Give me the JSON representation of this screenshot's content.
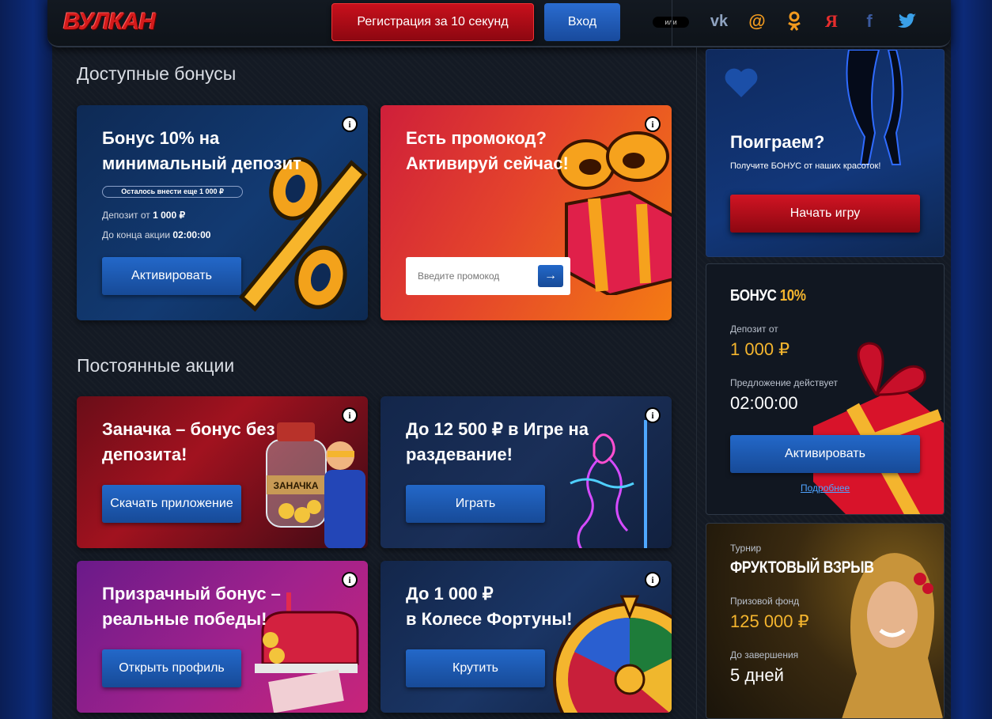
{
  "header": {
    "logo": "ВУЛКАН",
    "register_label": "Регистрация за 10 секунд",
    "login_label": "Вход",
    "or_label": "или",
    "socials": [
      "vk-icon",
      "mail-at-icon",
      "odnoklassniki-icon",
      "yandex-icon",
      "facebook-icon",
      "twitter-icon"
    ]
  },
  "available": {
    "title": "Доступные бонусы",
    "bonus10": {
      "title_line1": "Бонус 10% на",
      "title_line2": "минимальный депозит",
      "remaining": "Осталось внести еще 1 000 ₽",
      "deposit_label": "Депозит от",
      "deposit_value": "1 000 ₽",
      "ends_label": "До конца акции",
      "ends_value": "02:00:00",
      "button": "Активировать"
    },
    "promo": {
      "title_line1": "Есть промокод?",
      "title_line2": "Активируй сейчас!",
      "placeholder": "Введите промокод",
      "submit_glyph": "→"
    }
  },
  "permanent": {
    "title": "Постоянные акции",
    "cards": [
      {
        "line1": "Заначка – бонус без",
        "line2": "депозита!",
        "button": "Скачать приложение",
        "jar_label": "ЗАНАЧКА"
      },
      {
        "line1": "До 12 500 ₽ в Игре на",
        "line2": "раздевание!",
        "button": "Играть"
      },
      {
        "line1": "Призрачный бонус –",
        "line2": "реальные победы!",
        "button": "Открыть профиль"
      },
      {
        "line1": "До 1 000 ₽",
        "line2": "в Колесе Фортуны!",
        "button": "Крутить"
      }
    ]
  },
  "sidebar": {
    "play": {
      "title": "Поиграем?",
      "subtitle": "Получите БОНУС от наших красоток!",
      "button": "Начать игру"
    },
    "bonus": {
      "title": "БОНУС",
      "title_accent": "10%",
      "deposit_label": "Депозит от",
      "deposit_value": "1 000 ₽",
      "offer_label": "Предложение действует",
      "offer_value": "02:00:00",
      "button": "Активировать",
      "more_link": "Подробнее"
    },
    "tournament": {
      "label": "Турнир",
      "title": "ФРУКТОВЫЙ ВЗРЫВ",
      "prize_label": "Призовой фонд",
      "prize_value": "125 000 ₽",
      "ends_label": "До завершения",
      "ends_value": "5 дней"
    }
  },
  "colors": {
    "brand_red": "#c8101c",
    "button_blue": "#2368c9",
    "gold": "#f4b52e",
    "background": "#141a24"
  }
}
